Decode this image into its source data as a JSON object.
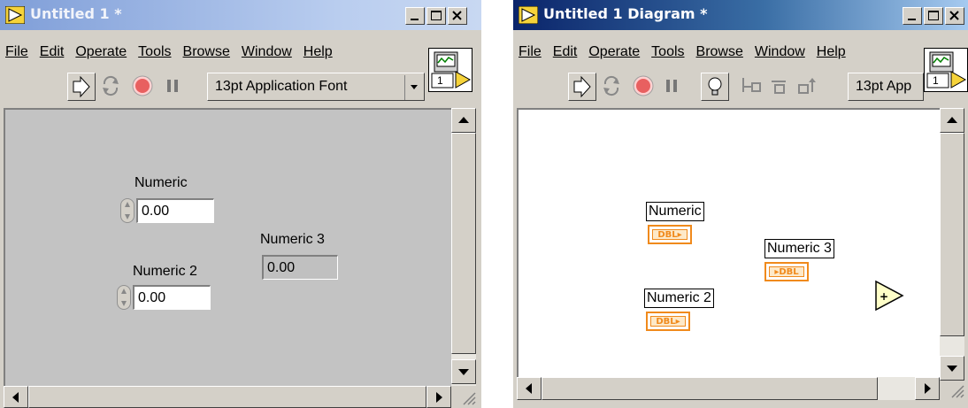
{
  "front_panel": {
    "title": "Untitled 1 *",
    "menu": [
      "File",
      "Edit",
      "Operate",
      "Tools",
      "Browse",
      "Window",
      "Help"
    ],
    "font": "13pt Application Font",
    "icon_connector": "1",
    "controls": [
      {
        "label": "Numeric",
        "value": "0.00"
      },
      {
        "label": "Numeric 2",
        "value": "0.00"
      }
    ],
    "indicator": {
      "label": "Numeric 3",
      "value": "0.00"
    }
  },
  "block_diagram": {
    "title": "Untitled 1 Diagram *",
    "menu": [
      "File",
      "Edit",
      "Operate",
      "Tools",
      "Browse",
      "Window",
      "Help"
    ],
    "font": "13pt App",
    "icon_connector": "1",
    "terminals": [
      {
        "label": "Numeric",
        "type": "DBL"
      },
      {
        "label": "Numeric 2",
        "type": "DBL"
      },
      {
        "label": "Numeric 3",
        "type": "DBL"
      }
    ],
    "add_function": "+"
  },
  "colors": {
    "dbl_terminal": "#f08a1c",
    "panel_gray": "#c3c3c3",
    "diagram_bg": "#ffffff",
    "titlebar_active": "#0a246a"
  },
  "icons": [
    "labview-run-icon",
    "run-arrow-icon",
    "run-continuous-icon",
    "abort-icon",
    "pause-icon",
    "highlight-bulb-icon",
    "step-into-icon",
    "step-over-icon",
    "step-out-icon"
  ]
}
